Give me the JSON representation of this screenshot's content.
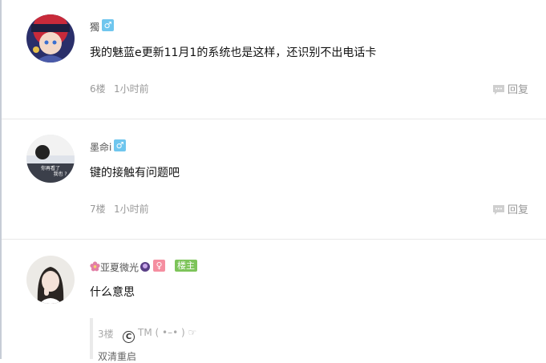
{
  "posts": [
    {
      "username": "獨",
      "gender_icon": "male-icon",
      "gender_symbol": "♂",
      "content": "我的魅蓝e更新11月1的系统也是这样，还识别不出电话卡",
      "floor": "6楼",
      "time": "1小时前",
      "reply_label": "回复"
    },
    {
      "username": "墨命i",
      "gender_icon": "male-icon",
      "gender_symbol": "♂",
      "content": "键的接触有问题吧",
      "floor": "7楼",
      "time": "1小时前",
      "reply_label": "回复",
      "avatar_text": "你再看了 我也 ?"
    },
    {
      "username": "亚夏微光",
      "gender_icon": "female-icon",
      "gender_symbol": "♀",
      "owner_badge": "楼主",
      "content": "什么意思",
      "quote": {
        "floor": "3楼",
        "author": "TM ( •–• ) ☞",
        "text": "双清重启"
      }
    }
  ],
  "colors": {
    "male": "#6fc6ee",
    "female": "#f58ea0",
    "owner": "#7dc45a",
    "meta": "#999999"
  }
}
